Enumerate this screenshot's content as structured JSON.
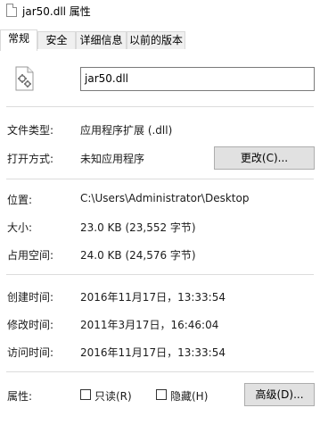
{
  "window": {
    "title": "jar50.dll 属性"
  },
  "tabs": [
    "常规",
    "安全",
    "详细信息",
    "以前的版本"
  ],
  "general": {
    "file_icon": "gear-file-icon",
    "file_name": "jar50.dll",
    "type_label": "文件类型:",
    "type_value": "应用程序扩展 (.dll)",
    "opens_label": "打开方式:",
    "opens_value": "未知应用程序",
    "change_button": "更改(C)...",
    "location_label": "位置:",
    "location_value": "C:\\Users\\Administrator\\Desktop",
    "size_label": "大小:",
    "size_value": "23.0 KB (23,552 字节)",
    "size_on_disk_label": "占用空间:",
    "size_on_disk_value": "24.0 KB (24,576 字节)",
    "created_label": "创建时间:",
    "created_value": "2016年11月17日，13:33:54",
    "modified_label": "修改时间:",
    "modified_value": "2011年3月17日，16:46:04",
    "accessed_label": "访问时间:",
    "accessed_value": "2016年11月17日，13:33:54",
    "attributes_label": "属性:",
    "readonly_label": "只读(R)",
    "hidden_label": "隐藏(H)",
    "advanced_button": "高级(D)..."
  }
}
